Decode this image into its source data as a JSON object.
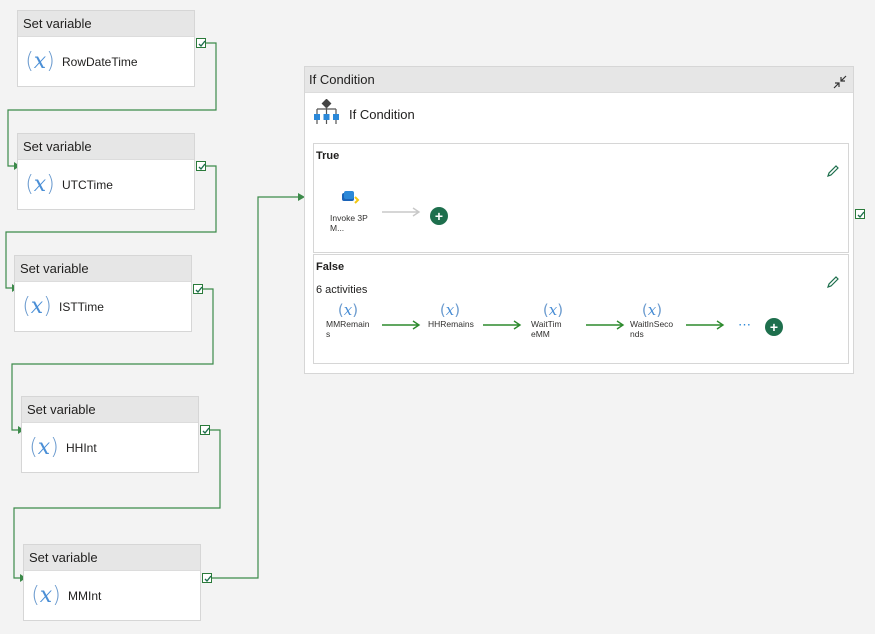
{
  "activities": [
    {
      "type": "Set variable",
      "name": "RowDateTime"
    },
    {
      "type": "Set variable",
      "name": "UTCTime"
    },
    {
      "type": "Set variable",
      "name": "ISTTime"
    },
    {
      "type": "Set variable",
      "name": "HHInt"
    },
    {
      "type": "Set variable",
      "name": "MMInt"
    }
  ],
  "if_condition": {
    "header": "If Condition",
    "subtitle": "If Condition",
    "true_branch": {
      "title": "True",
      "activity_label": "Invoke 3PM..."
    },
    "false_branch": {
      "title": "False",
      "count": "6 activities",
      "activities": [
        "MMRemains",
        "HHRemains",
        "WaitTimeMM",
        "WaitInSeconds"
      ],
      "more": "⋯"
    }
  },
  "icons": {
    "variable": "variable-x-icon",
    "success_check": "check-icon",
    "collapse": "collapse-icon",
    "edit": "pencil-icon",
    "add": "plus-icon",
    "invoke": "invoke-pipeline-icon",
    "if_condition": "if-condition-icon"
  },
  "colors": {
    "success_wire": "#3c8a4a",
    "add_button": "#1e6f4d",
    "variable_icon": "#4b8fd6"
  }
}
